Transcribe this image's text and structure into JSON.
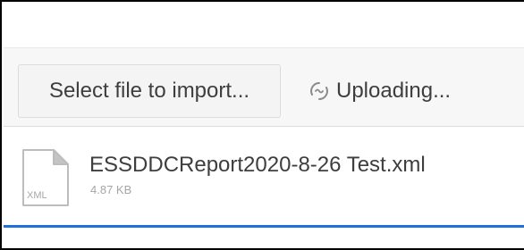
{
  "toolbar": {
    "select_button_label": "Select file to import...",
    "status_text": "Uploading...",
    "status_icon": "spinner-icon"
  },
  "file": {
    "name": "ESSDDCReport2020-8-26 Test.xml",
    "size": "4.87 KB",
    "type_label": "XML",
    "icon": "xml-file-icon"
  },
  "upload": {
    "progress_percent": 100
  },
  "colors": {
    "accent": "#1f6fdc",
    "toolbar_bg": "#f7f7f7",
    "text": "#3e3e3e",
    "muted_text": "#a6a6a6"
  }
}
